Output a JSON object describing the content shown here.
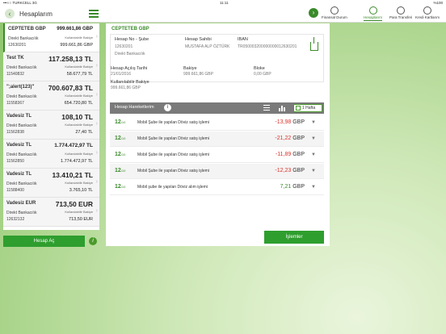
{
  "status": {
    "carrier": "•••○○ TURKCELL  3G",
    "time": "11:11",
    "battery": "%100"
  },
  "header": {
    "title": "Hesaplarım",
    "nav": [
      {
        "label": "Finansal Durum",
        "icon": "pie-chart-icon"
      },
      {
        "label": "Hesaplarım",
        "icon": "binoculars-icon",
        "active": true
      },
      {
        "label": "Para Transferi",
        "icon": "transfer-icon"
      },
      {
        "label": "Kredi Kartlarım",
        "icon": "card-icon"
      }
    ]
  },
  "sidebar": {
    "accounts": [
      {
        "name": "CEPTETEB GBP",
        "balance": "999.661,86 GBP",
        "bank": "Direkt Bankacılık",
        "number": "12630201",
        "available_label": "Kullanılabilir Bakiye",
        "available": "999.661,86 GBP",
        "selected": true
      },
      {
        "name": "Test TK",
        "balance": "117.258,13 TL",
        "bank": "Direkt Bankacılık",
        "number": "11540832",
        "available_label": "Kullanılabilir Bakiye",
        "available": "58.677,79 TL"
      },
      {
        "name": "\";alert(123)\"",
        "balance": "700.607,83 TL",
        "bank": "Direkt Bankacılık",
        "number": "11558367",
        "available_label": "Kullanılabilir Bakiye",
        "available": "654.720,80 TL"
      },
      {
        "name": "Vadesiz TL",
        "balance": "108,10 TL",
        "bank": "Direkt Bankacılık",
        "number": "11562838",
        "available_label": "Kullanılabilir Bakiye",
        "available": "27,40 TL"
      },
      {
        "name": "Vadesiz TL",
        "balance": "1.774.472,97 TL",
        "bank": "Direkt Bankacılık",
        "number": "11562850",
        "available_label": "Kullanılabilir Bakiye",
        "available": "1.774.472,97 TL"
      },
      {
        "name": "Vadesiz TL",
        "balance": "13.410,21 TL",
        "bank": "Direkt Bankacılık",
        "number": "11588400",
        "available_label": "Kullanılabilir Bakiye",
        "available": "3.765,10 TL"
      },
      {
        "name": "Vadesiz EUR",
        "balance": "713,50 EUR",
        "bank": "Direkt Bankacılık",
        "number": "12632132",
        "available_label": "Kullanılabilir Bakiye",
        "available": "713,50 EUR"
      }
    ],
    "open_account_label": "Hesap Aç"
  },
  "detail": {
    "account_name": "CEPTETEB GBP",
    "branch_label": "Hesap No - Şube",
    "branch_value": "12630201",
    "branch_type": "Direkt Bankacılık",
    "owner_label": "Hesap Sahibi",
    "owner_value": "MUSTAFA ALP ÖZTÜRK",
    "iban_label": "IBAN",
    "iban_value": "TR050003200000000012630201",
    "open_date_label": "Hesap Açılış Tarihi",
    "open_date_value": "21/01/2016",
    "balance_label": "Bakiye",
    "balance_value": "999.661,86 GBP",
    "blocked_label": "Bloke",
    "blocked_value": "0,00 GBP",
    "available_label": "Kullanılabilir Bakiye",
    "available_value": "999.661,86 GBP"
  },
  "transactions": {
    "title": "Hesap Hareketlerim",
    "period": "1 Hafta",
    "rows": [
      {
        "day": "12",
        "month": "/10",
        "desc": "Mobil Şube ile yapılan Döviz satış işlemi",
        "amount": "-13,98",
        "currency": "GBP",
        "negative": true
      },
      {
        "day": "12",
        "month": "/10",
        "desc": "Mobil Şube ile yapılan Döviz satış işlemi",
        "amount": "-21,22",
        "currency": "GBP",
        "negative": true
      },
      {
        "day": "12",
        "month": "/10",
        "desc": "Mobil Şube ile yapılan Döviz satış işlemi",
        "amount": "-11,89",
        "currency": "GBP",
        "negative": true
      },
      {
        "day": "12",
        "month": "/10",
        "desc": "Mobil Şube ile yapılan Döviz satış işlemi",
        "amount": "-12,23",
        "currency": "GBP",
        "negative": true
      },
      {
        "day": "12",
        "month": "/10",
        "desc": "Mobil şube ile yapılan Döviz alım işlemi",
        "amount": "7,21",
        "currency": "GBP",
        "negative": false
      }
    ],
    "operations_label": "İşlemler"
  },
  "colors": {
    "accent": "#3a8a2a",
    "button": "#2e9e2e",
    "negative": "#d9342b"
  }
}
